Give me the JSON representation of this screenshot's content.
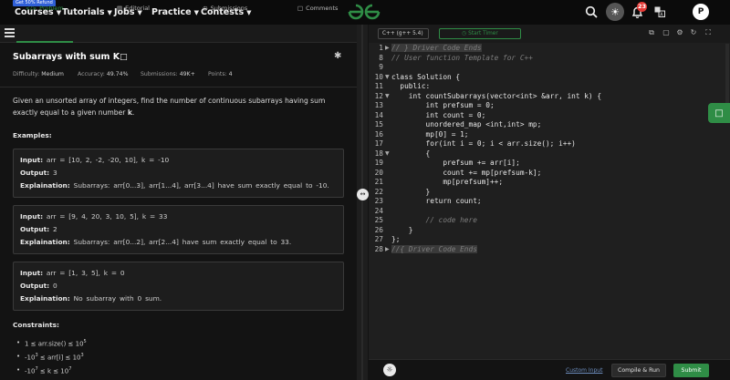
{
  "topnav": {
    "promo": "Get 50% Refund",
    "items": [
      "Courses",
      "Tutorials",
      "Jobs",
      "Practice",
      "Contests"
    ],
    "notification_count": "23",
    "avatar_letter": "P"
  },
  "problem_tabs": [
    "Problem",
    "Editorial",
    "Submissions",
    "Comments"
  ],
  "problem": {
    "title": "Subarrays with sum K",
    "difficulty_label": "Difficulty:",
    "difficulty": "Medium",
    "accuracy_label": "Accuracy:",
    "accuracy": "49.74%",
    "submissions_label": "Submissions:",
    "submissions": "49K+",
    "points_label": "Points:",
    "points": "4",
    "description_1": "Given an unsorted array of integers, find the number of continuous subarrays having sum exactly equal to a given number ",
    "description_k": "k",
    "description_end": ".",
    "examples_heading": "Examples:",
    "examples": [
      {
        "input_label": "Input:",
        "input": "arr = [10, 2, -2, -20, 10], k = -10",
        "output_label": "Output:",
        "output": "3",
        "expl_label": "Explaination:",
        "explanation": "Subarrays: arr[0...3], arr[1...4], arr[3...4] have sum exactly equal to -10."
      },
      {
        "input_label": "Input:",
        "input": "arr = [9, 4, 20, 3, 10, 5], k = 33",
        "output_label": "Output:",
        "output": "2",
        "expl_label": "Explaination:",
        "explanation": "Subarrays: arr[0...2], arr[2...4] have sum exactly equal to 33."
      },
      {
        "input_label": "Input:",
        "input": "arr = [1, 3, 5], k = 0",
        "output_label": "Output:",
        "output": "0",
        "expl_label": "Explaination:",
        "explanation": "No subarray with 0 sum."
      }
    ],
    "constraints_heading": "Constraints:",
    "constraints": [
      {
        "pre": "1 ≤ arr.size() ≤ 10",
        "sup": "5",
        "post": ""
      },
      {
        "pre": "-10",
        "sup": "3",
        "post": " ≤ arr[i] ≤ 10",
        "sup2": "3"
      },
      {
        "pre": "-10",
        "sup": "7",
        "post": " ≤ k ≤ 10",
        "sup2": "7"
      }
    ]
  },
  "editor": {
    "language": "C++ (g++ 5.4)",
    "timer_label": "Start Timer",
    "line_numbers": [
      "1",
      "8",
      "9",
      "10",
      "11",
      "12",
      "13",
      "14",
      "15",
      "16",
      "17",
      "18",
      "19",
      "20",
      "21",
      "22",
      "23",
      "24",
      "25",
      "26",
      "27",
      "28"
    ],
    "lines": [
      "// } Driver Code Ends",
      "// User function Template for C++",
      "",
      "class Solution {",
      "  public:",
      "    int countSubarrays(vector<int> &arr, int k) {",
      "        int prefsum = 0;",
      "        int count = 0;",
      "        unordered_map <int,int> mp;",
      "        mp[0] = 1;",
      "        for(int i = 0; i < arr.size(); i++)",
      "        {",
      "            prefsum += arr[i];",
      "            count += mp[prefsum-k];",
      "            mp[prefsum]++;",
      "        }",
      "        return count;",
      "",
      "        // code here",
      "    }",
      "};",
      "//{ Driver Code Ends"
    ]
  },
  "footer": {
    "custom_input": "Custom Input",
    "compile_run": "Compile & Run",
    "submit": "Submit"
  }
}
